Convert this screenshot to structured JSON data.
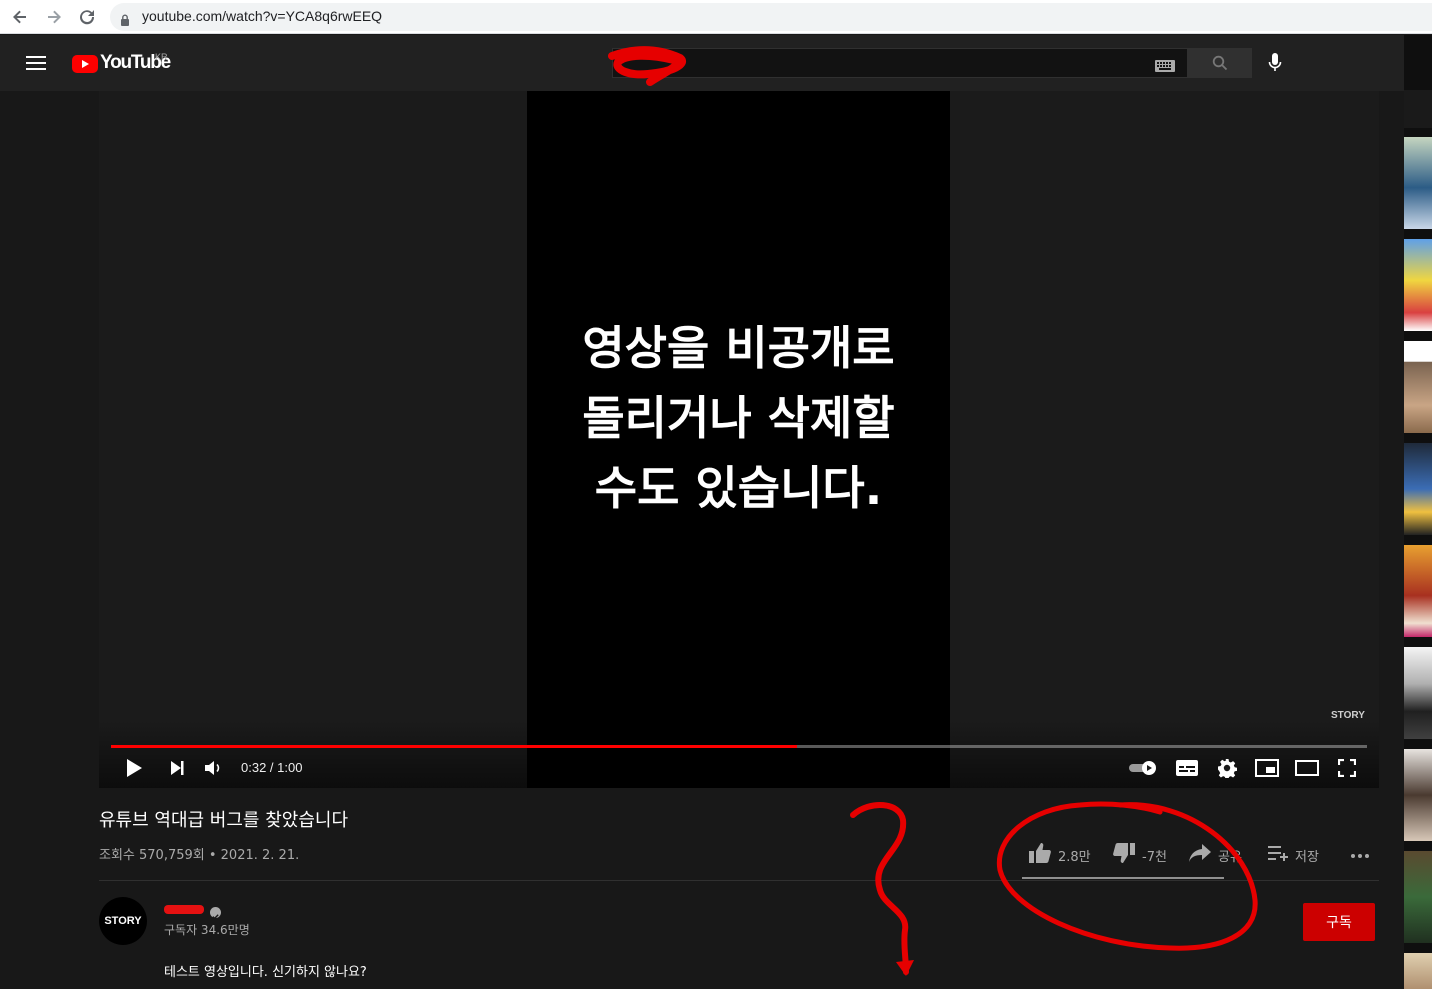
{
  "browser": {
    "url": "youtube.com/watch?v=YCA8q6rwEEQ",
    "icons": [
      "back-arrow-icon",
      "forward-arrow-icon",
      "reload-icon",
      "lock-icon"
    ]
  },
  "header": {
    "logo_text": "YouTube",
    "country_code": "KR",
    "search_placeholder": "",
    "icons": [
      "menu-icon",
      "youtube-play-icon",
      "keyboard-icon",
      "search-icon",
      "microphone-icon"
    ]
  },
  "player": {
    "caption_text": "영상을 비공개로\n돌리거나 삭제할\n수도 있습니다.",
    "watermark": "STORY",
    "time": "0:32 / 1:00",
    "progress_fraction": 0.5458,
    "icons": [
      "play-icon",
      "next-icon",
      "volume-icon",
      "autoplay-toggle-icon",
      "subtitles-icon",
      "settings-icon",
      "miniplayer-icon",
      "theater-mode-icon",
      "fullscreen-icon"
    ]
  },
  "video": {
    "title": "유튜브 역대급 버그를 찾았습니다",
    "meta": "조회수 570,759회 • 2021. 2. 21.",
    "actions": {
      "like_count": "2.8만",
      "dislike_count": "-7천",
      "share_label": "공유",
      "save_label": "저장"
    },
    "like_ratio": 1.0
  },
  "channel": {
    "avatar_text": "STORY",
    "subscribers": "구독자 34.6만명",
    "subscribe_label": "구독",
    "description": "테스트 영상입니다. 신기하지 않나요?"
  },
  "colors": {
    "accent": "#ff0000",
    "subscribe": "#cc0000",
    "background": "#181818",
    "annotation": "#e60000"
  }
}
